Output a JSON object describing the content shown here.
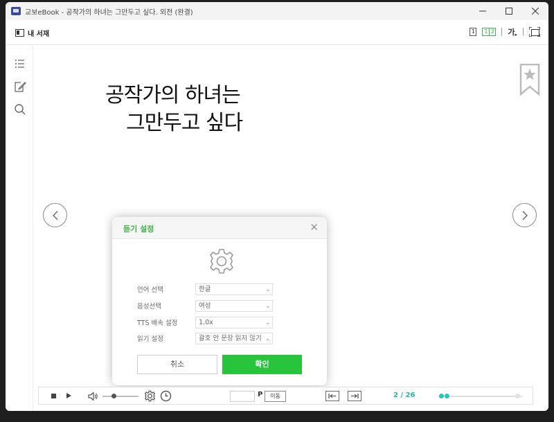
{
  "window": {
    "title": "교보eBook  -  공작가의 하녀는 그만두고 싶다. 외전 (완결)"
  },
  "toolbar": {
    "library_label": "내 서재",
    "single_page_label": "1",
    "double_page_labels": [
      "1",
      "2"
    ],
    "font_label": "가"
  },
  "book": {
    "title_line1": "공작가의 하녀는",
    "title_line2": "그만두고 싶다"
  },
  "dialog": {
    "title": "듣기 설정",
    "settings": [
      {
        "label": "언어 선택",
        "value": "한글"
      },
      {
        "label": "음성선택",
        "value": "여성"
      },
      {
        "label": "TTS 배속 설정",
        "value": "1.0x"
      },
      {
        "label": "읽기 설정",
        "value": "괄호 안 문장 읽지 않기"
      }
    ],
    "cancel_label": "취소",
    "confirm_label": "확인"
  },
  "player": {
    "page_input_value": "",
    "page_unit": "P",
    "move_label": "이동",
    "page_count": "2 / 26",
    "reading_progress": 0.077
  },
  "colors": {
    "accent_green": "#28c43c",
    "progress_teal": "#2bc4b8"
  }
}
